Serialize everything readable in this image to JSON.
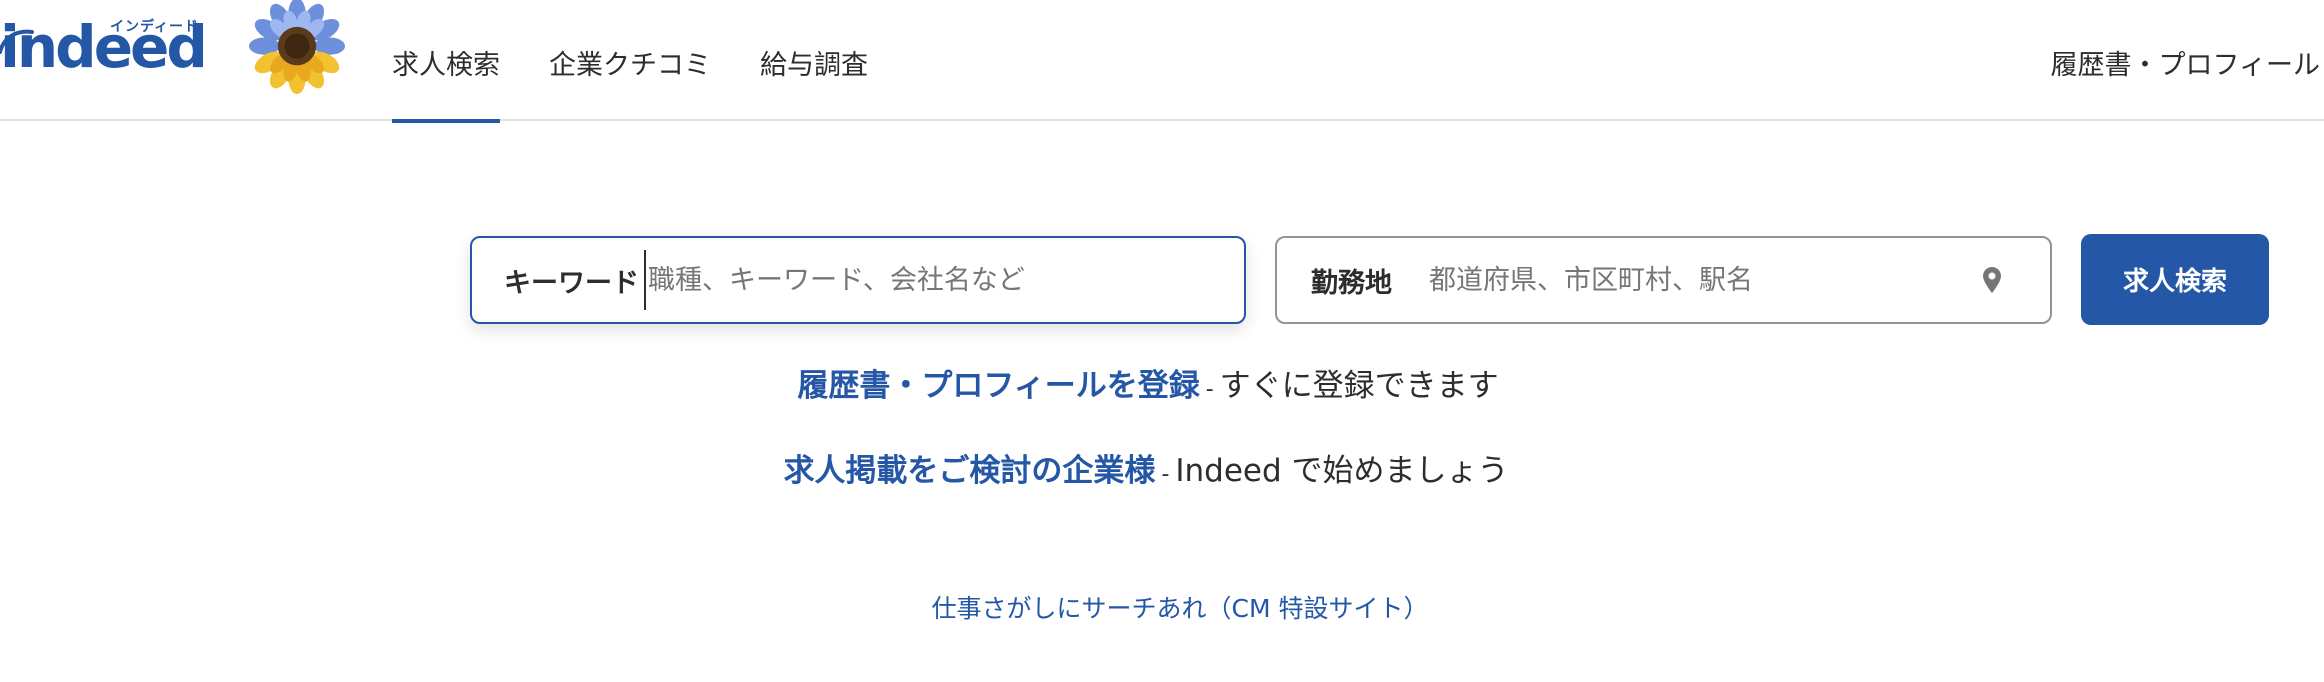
{
  "header": {
    "logo": {
      "wordmark": "indeed",
      "kana": "インディード"
    },
    "nav": [
      {
        "label": "求人検索",
        "active": true
      },
      {
        "label": "企業クチコミ",
        "active": false
      },
      {
        "label": "給与調査",
        "active": false
      }
    ],
    "right_link": "履歴書・プロフィール"
  },
  "search": {
    "what": {
      "label": "キーワード",
      "placeholder": "職種、キーワード、会社名など",
      "value": ""
    },
    "where": {
      "label": "勤務地",
      "placeholder": "都道府県、市区町村、駅名",
      "value": "",
      "icon": "location-pin-icon"
    },
    "button_label": "求人検索"
  },
  "promos": [
    {
      "link": "履歴書・プロフィールを登録",
      "separator": "-",
      "text": "すぐに登録できます"
    },
    {
      "link": "求人掲載をご検討の企業様",
      "separator": "-",
      "text": "Indeed で始めましょう"
    }
  ],
  "footer_link": "仕事さがしにサーチあれ（CM 特設サイト）",
  "colors": {
    "brand": "#2557a7",
    "text": "#2d2d2d",
    "placeholder": "#767676",
    "border": "#949494",
    "divider": "#e4e2e0"
  }
}
